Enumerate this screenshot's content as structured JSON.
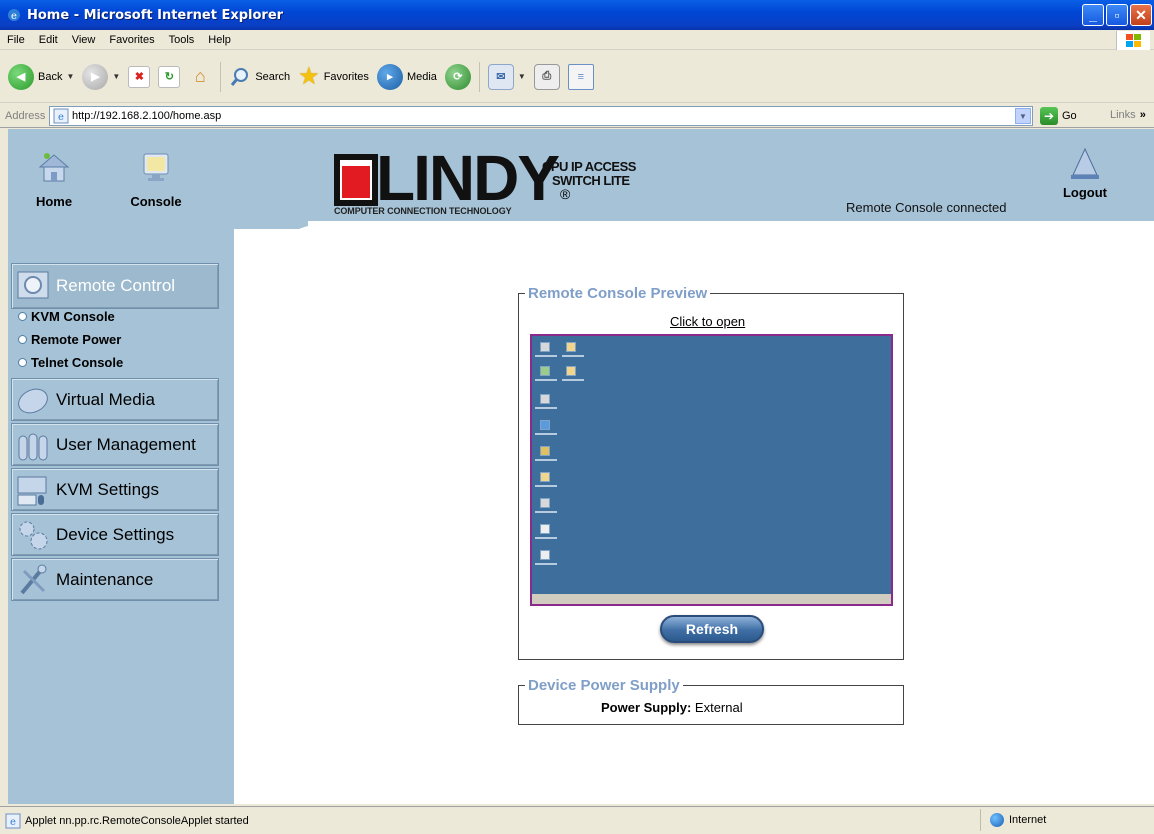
{
  "window": {
    "title": "Home - Microsoft Internet Explorer",
    "minimize": "_",
    "maximize": "▫",
    "close": "✕"
  },
  "menu": [
    "File",
    "Edit",
    "View",
    "Favorites",
    "Tools",
    "Help"
  ],
  "toolbar": {
    "back_label": "Back",
    "search_label": "Search",
    "favorites_label": "Favorites",
    "media_label": "Media"
  },
  "address": {
    "label": "Address",
    "url": "http://192.168.2.100/home.asp",
    "go_label": "Go",
    "links_label": "Links"
  },
  "header": {
    "home_label": "Home",
    "console_label": "Console",
    "brand": "LINDY",
    "brand_tagline": "COMPUTER CONNECTION TECHNOLOGY",
    "product_line1": "CPU IP ACCESS",
    "product_line2": "SWITCH LITE",
    "status": "Remote Console connected",
    "logout_label": "Logout"
  },
  "sidebar": {
    "sections": [
      {
        "label": "Remote Control",
        "icon": "monitor-icon"
      },
      {
        "label": "Virtual Media",
        "icon": "disc-icon"
      },
      {
        "label": "User Management",
        "icon": "users-icon"
      },
      {
        "label": "KVM Settings",
        "icon": "keyboard-icon"
      },
      {
        "label": "Device Settings",
        "icon": "gears-icon"
      },
      {
        "label": "Maintenance",
        "icon": "tools-icon"
      }
    ],
    "sub_items": [
      "KVM Console",
      "Remote Power",
      "Telnet Console"
    ]
  },
  "preview": {
    "legend": "Remote Console Preview",
    "click_to_open": "Click to open",
    "refresh_label": "Refresh"
  },
  "power": {
    "legend": "Device Power Supply",
    "key": "Power Supply:",
    "value": "External"
  },
  "status_bar": {
    "text": "Applet nn.pp.rc.RemoteConsoleApplet started",
    "zone": "Internet"
  },
  "colors": {
    "panel_bg": "#a6c2d6",
    "legend_text": "#7f9fc8",
    "preview_border": "#8a2a8a",
    "desktop_bg": "#3e6e9c"
  }
}
